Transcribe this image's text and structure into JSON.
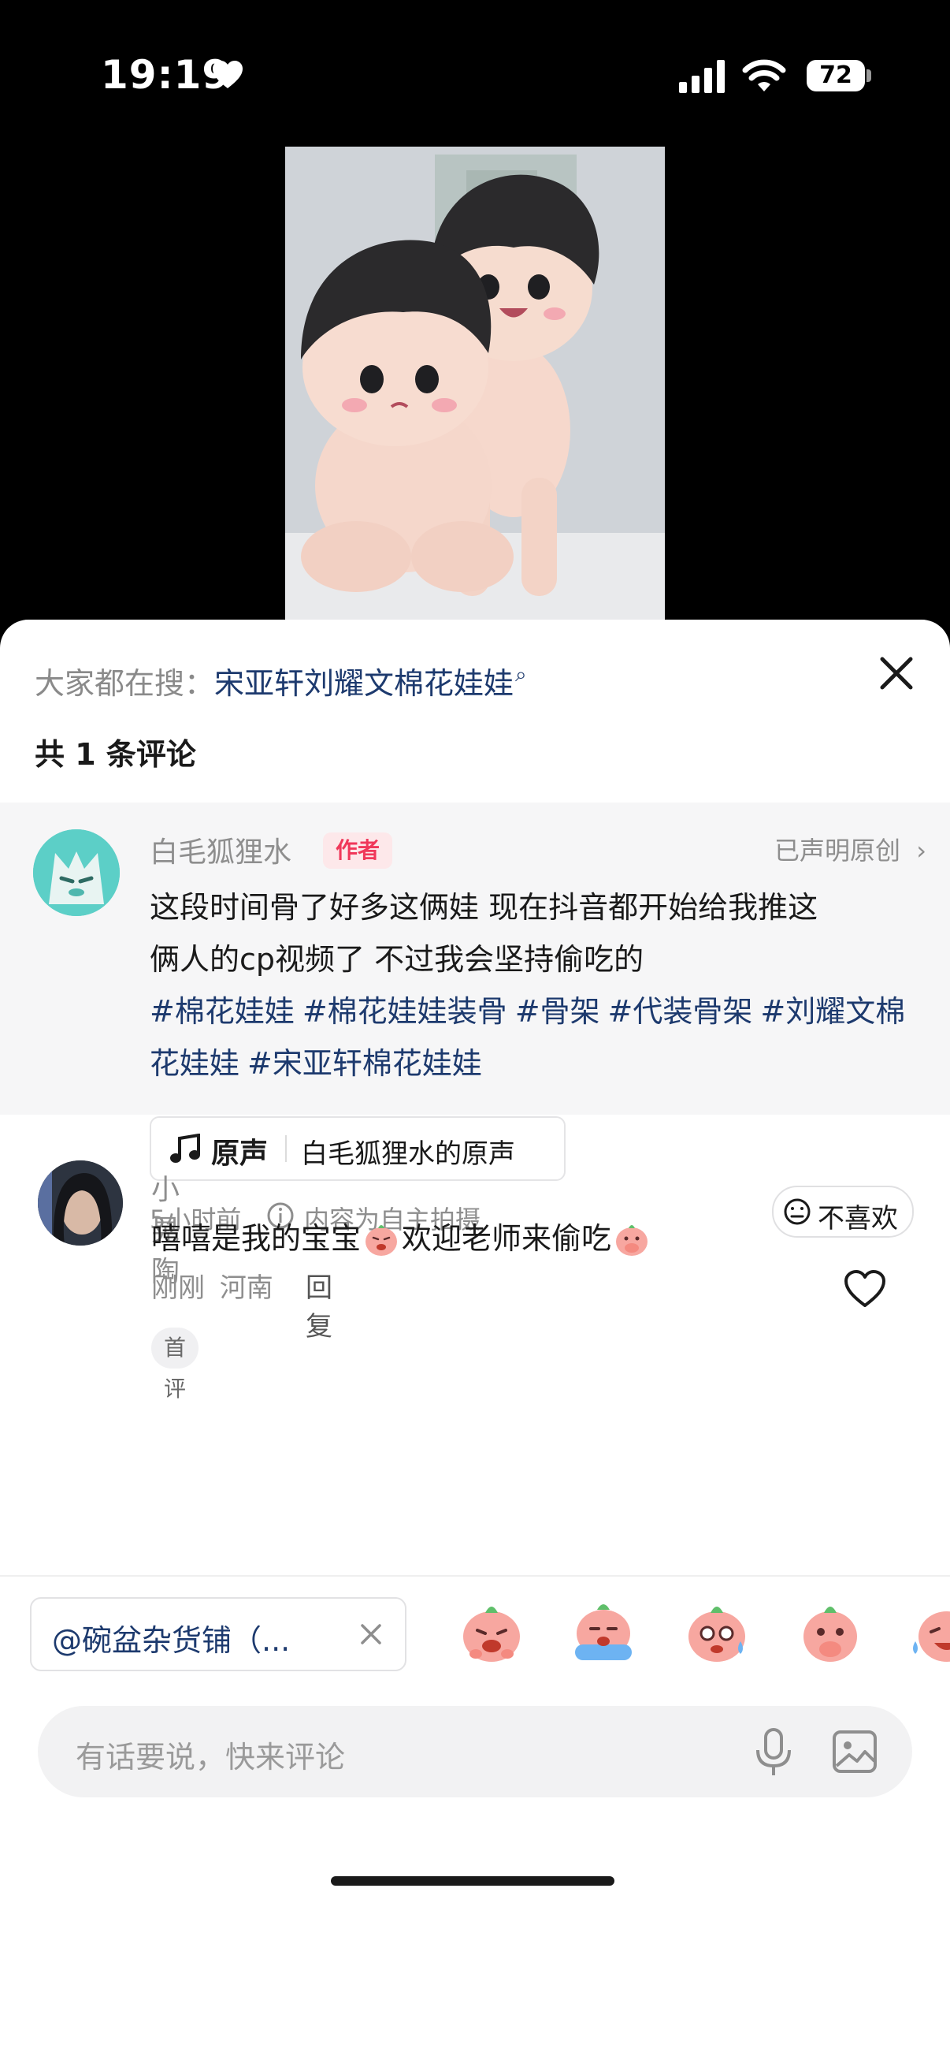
{
  "status_bar": {
    "time": "19:19",
    "battery": "72"
  },
  "sheet": {
    "search_hint_prefix": "大家都在搜：",
    "search_hint_keyword": "宋亚轩刘耀文棉花娃娃",
    "comment_count": "共 1 条评论"
  },
  "author_post": {
    "name": "白毛狐狸水",
    "badge": "作者",
    "original_declaration": "已声明原创",
    "text_line1": "这段时间骨了好多这俩娃 现在抖音都开始给我推这",
    "text_line2": "俩人的cp视频了 不过我会坚持偷吃的",
    "tags": [
      "#棉花娃娃",
      "#棉花娃娃装骨",
      "#骨架",
      "#代装骨架",
      "#刘耀文棉花娃娃",
      "#宋亚轩棉花娃娃"
    ],
    "music_label": "原声",
    "music_title": "白毛狐狸水的原声",
    "time": "5小时前",
    "content_note": "内容为自主拍摄",
    "dislike_label": "不喜欢"
  },
  "comments": [
    {
      "user": "小晃陶",
      "text_part1": "嘻嘻是我的宝宝",
      "text_part2": "欢迎老师来偷吃",
      "time": "刚刚",
      "location": "河南",
      "reply_label": "回复",
      "badge": "首评"
    }
  ],
  "bottom": {
    "mention_chip": "@碗盆杂货铺（...",
    "input_placeholder": "有话要说，快来评论"
  },
  "colors": {
    "link": "#1d3a6e",
    "author_badge": "#f0385a",
    "avatar_teal": "#5ccfc7"
  }
}
